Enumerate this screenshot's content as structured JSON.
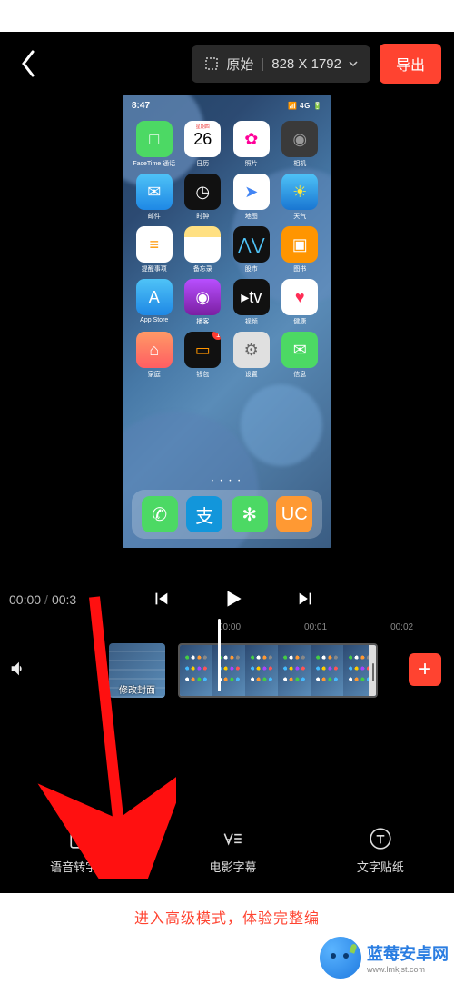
{
  "header": {
    "original_label": "原始",
    "resolution": "828 X 1792",
    "export_label": "导出"
  },
  "phone": {
    "time": "8:47",
    "signal": "4G",
    "apps": [
      {
        "label": "FaceTime 通话",
        "bg": "#4cd964",
        "glyph": "□"
      },
      {
        "label": "日历",
        "bg": "#ffffff",
        "glyph": "26",
        "top": "星期四",
        "color": "#000"
      },
      {
        "label": "照片",
        "bg": "#ffffff",
        "glyph": "✿",
        "color": "#f09"
      },
      {
        "label": "相机",
        "bg": "#3a3a3a",
        "glyph": "◉",
        "color": "#999"
      },
      {
        "label": "邮件",
        "bg": "linear-gradient(#4fc3f7,#1e88e5)",
        "glyph": "✉",
        "color": "#fff"
      },
      {
        "label": "时钟",
        "bg": "#111",
        "glyph": "◷",
        "color": "#fff"
      },
      {
        "label": "地图",
        "bg": "#fff",
        "glyph": "➤",
        "color": "#4285f4"
      },
      {
        "label": "天气",
        "bg": "linear-gradient(#4fc3f7,#1976d2)",
        "glyph": "☀",
        "color": "#ffeb3b"
      },
      {
        "label": "提醒事项",
        "bg": "#fff",
        "glyph": "≡",
        "color": "#ff9500"
      },
      {
        "label": "备忘录",
        "bg": "linear-gradient(#ffe082 30%,#fff 30%)",
        "glyph": "",
        "color": "#999"
      },
      {
        "label": "股市",
        "bg": "#111",
        "glyph": "⋀⋁",
        "color": "#4fc3f7"
      },
      {
        "label": "图书",
        "bg": "#ff9500",
        "glyph": "▣",
        "color": "#fff"
      },
      {
        "label": "App Store",
        "bg": "linear-gradient(#4fc3f7,#1e88e5)",
        "glyph": "A",
        "color": "#fff"
      },
      {
        "label": "播客",
        "bg": "linear-gradient(#b84fff,#7b1fa2)",
        "glyph": "◉",
        "color": "#fff"
      },
      {
        "label": "视频",
        "bg": "#111",
        "glyph": "▸tv",
        "color": "#fff"
      },
      {
        "label": "健康",
        "bg": "#fff",
        "glyph": "♥",
        "color": "#ff2d55"
      },
      {
        "label": "家庭",
        "bg": "linear-gradient(#ff9966,#ff5e62)",
        "glyph": "⌂",
        "color": "#fff"
      },
      {
        "label": "钱包",
        "bg": "#111",
        "glyph": "▭",
        "color": "#ff9500",
        "badge": "1"
      },
      {
        "label": "设置",
        "bg": "#e0e0e0",
        "glyph": "⚙",
        "color": "#666"
      },
      {
        "label": "信息",
        "bg": "#4cd964",
        "glyph": "✉",
        "color": "#fff"
      }
    ],
    "dock": [
      {
        "bg": "#4cd964",
        "glyph": "✆",
        "color": "#fff"
      },
      {
        "bg": "#1296db",
        "glyph": "支",
        "color": "#fff"
      },
      {
        "bg": "#4cd964",
        "glyph": "✻",
        "color": "#fff"
      },
      {
        "bg": "#ff9933",
        "glyph": "UC",
        "color": "#fff"
      }
    ]
  },
  "playback": {
    "current": "00:00",
    "total": "00:3",
    "ticks": [
      "00:00",
      "00:01",
      "00:02"
    ]
  },
  "timeline": {
    "cover_label": "修改封面"
  },
  "tools": [
    {
      "id": "voice-subtitle",
      "label": "语音转字幕"
    },
    {
      "id": "movie-subtitle",
      "label": "电影字幕"
    },
    {
      "id": "text-sticker",
      "label": "文字贴纸"
    }
  ],
  "advanced_label": "进入高级模式，体验完整编",
  "watermark": "蓝莓安卓网",
  "watermark_url": "www.lmkjst.com"
}
